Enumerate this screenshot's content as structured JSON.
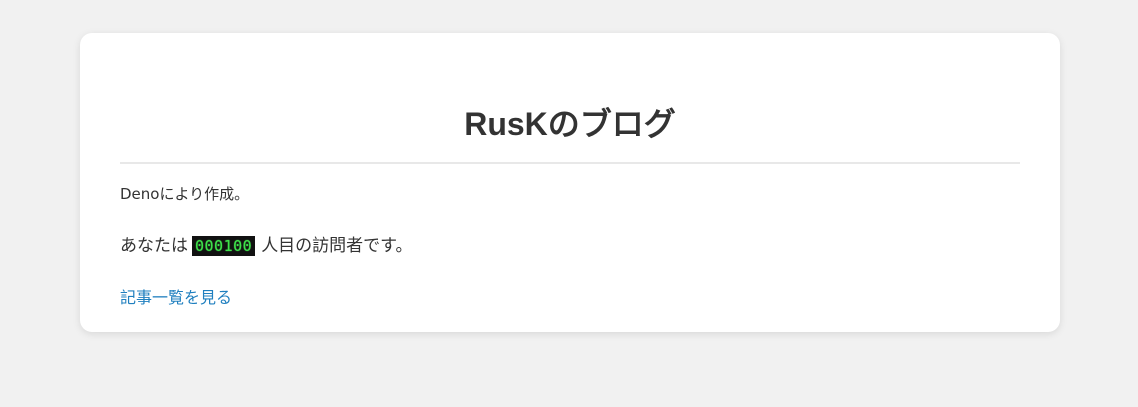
{
  "page": {
    "title": "RusKのブログ",
    "credit": "Denoにより作成。",
    "visitor": {
      "prefix": "あなたは",
      "count": "000100",
      "suffix": "人目の訪問者です。"
    },
    "link_label": "記事一覧を見る"
  },
  "colors": {
    "background": "#f1f1f1",
    "card": "#ffffff",
    "text": "#333333",
    "link": "#1f7fbf",
    "counter_bg": "#111111",
    "counter_digits": "#3ee14a"
  }
}
